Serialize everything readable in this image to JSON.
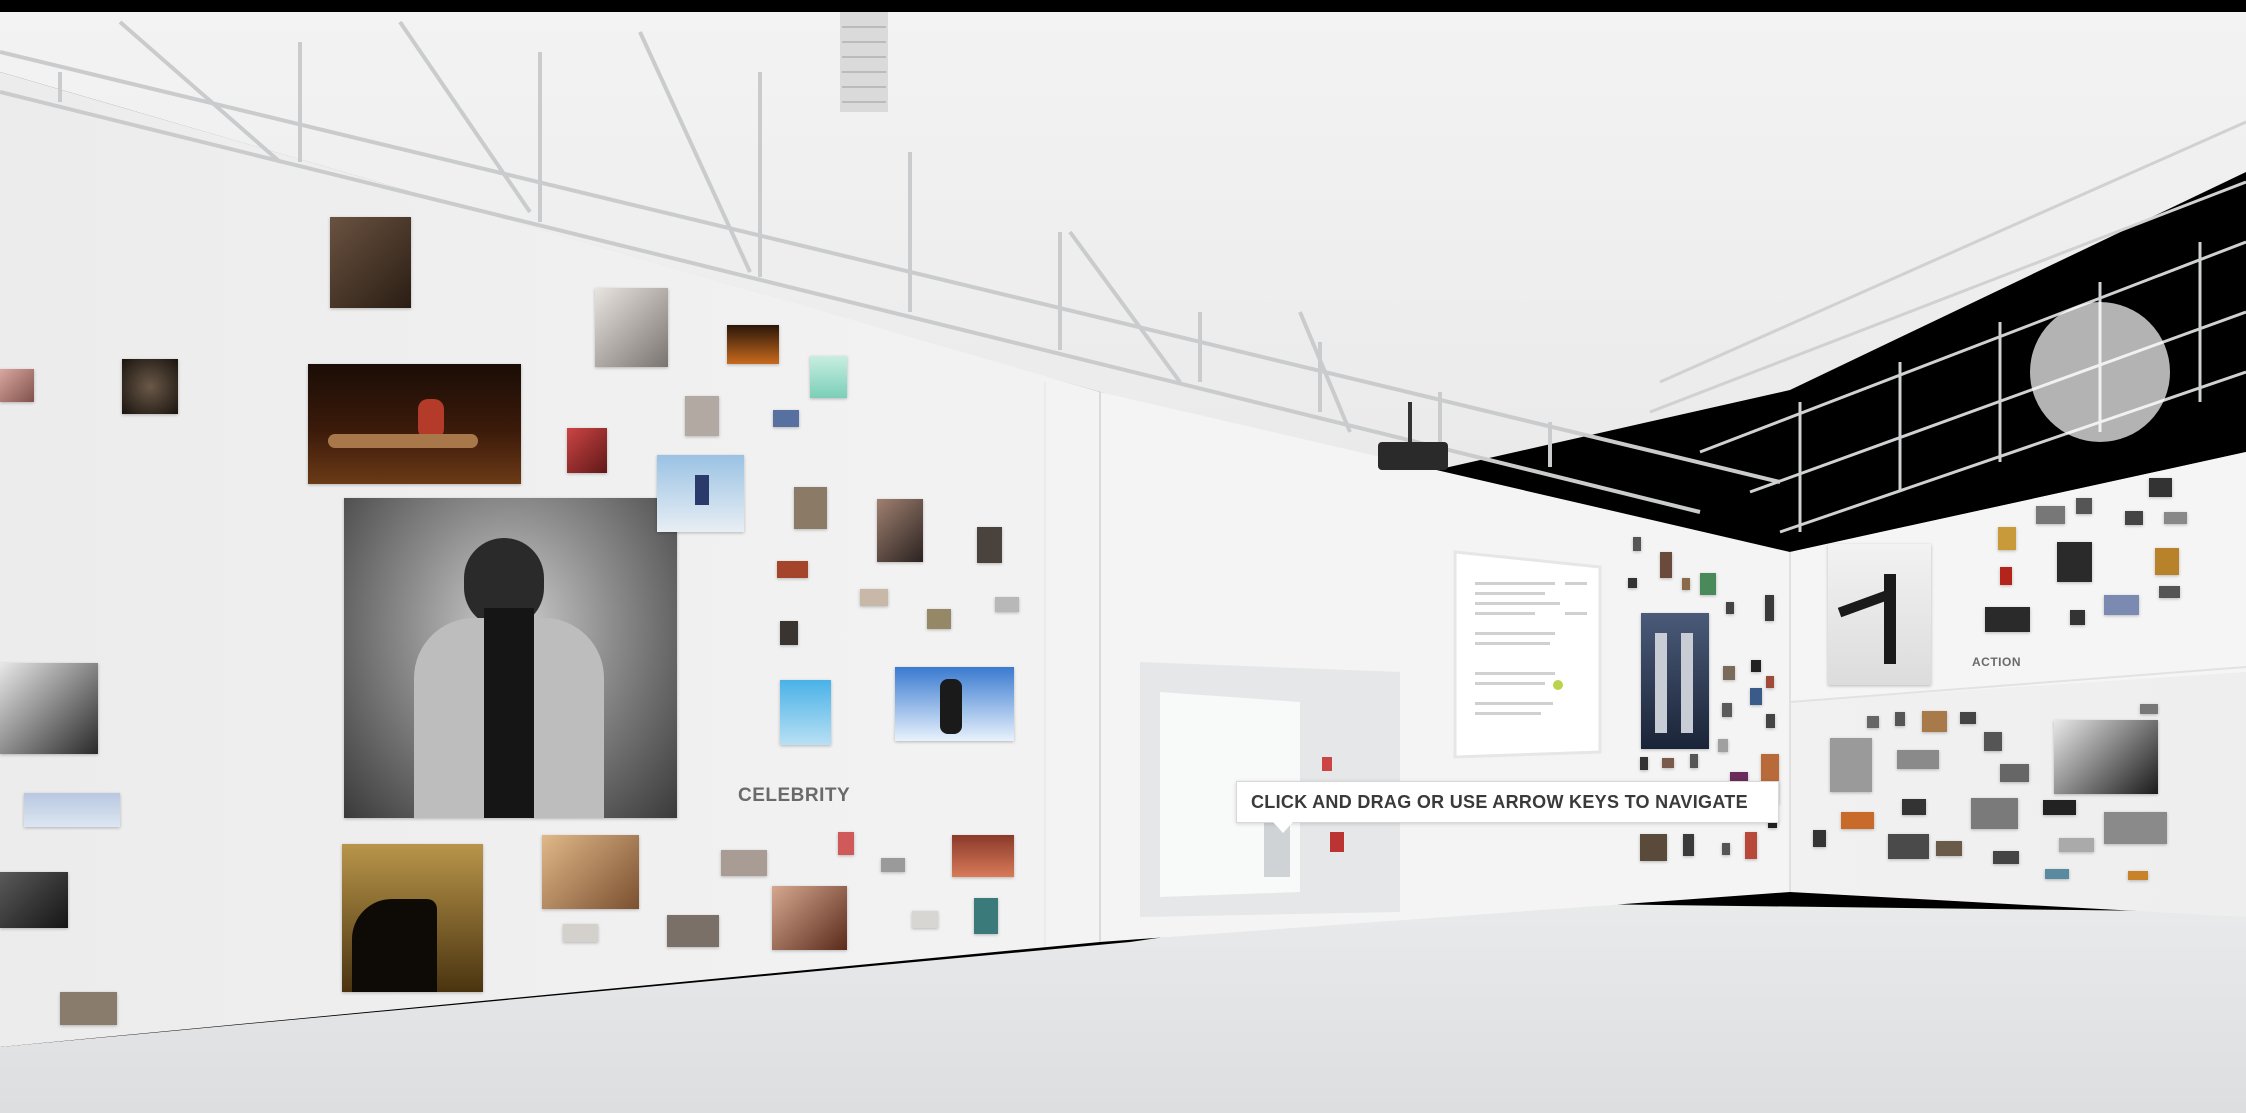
{
  "viewer": {
    "label_celebrity": "CELEBRITY",
    "label_action": "ACTION",
    "tooltip": "CLICK AND DRAG OR USE ARROW KEYS TO NAVIGATE"
  },
  "colors": {
    "wall": "#efefef",
    "floor": "#e4e6e8",
    "ceiling": "#f2f2f2",
    "beam": "#c9cbcc",
    "label_text": "#6a6a6a"
  },
  "photos": {
    "count_left_wall": 38,
    "count_far_wall": 40,
    "count_right_wall": 34
  }
}
